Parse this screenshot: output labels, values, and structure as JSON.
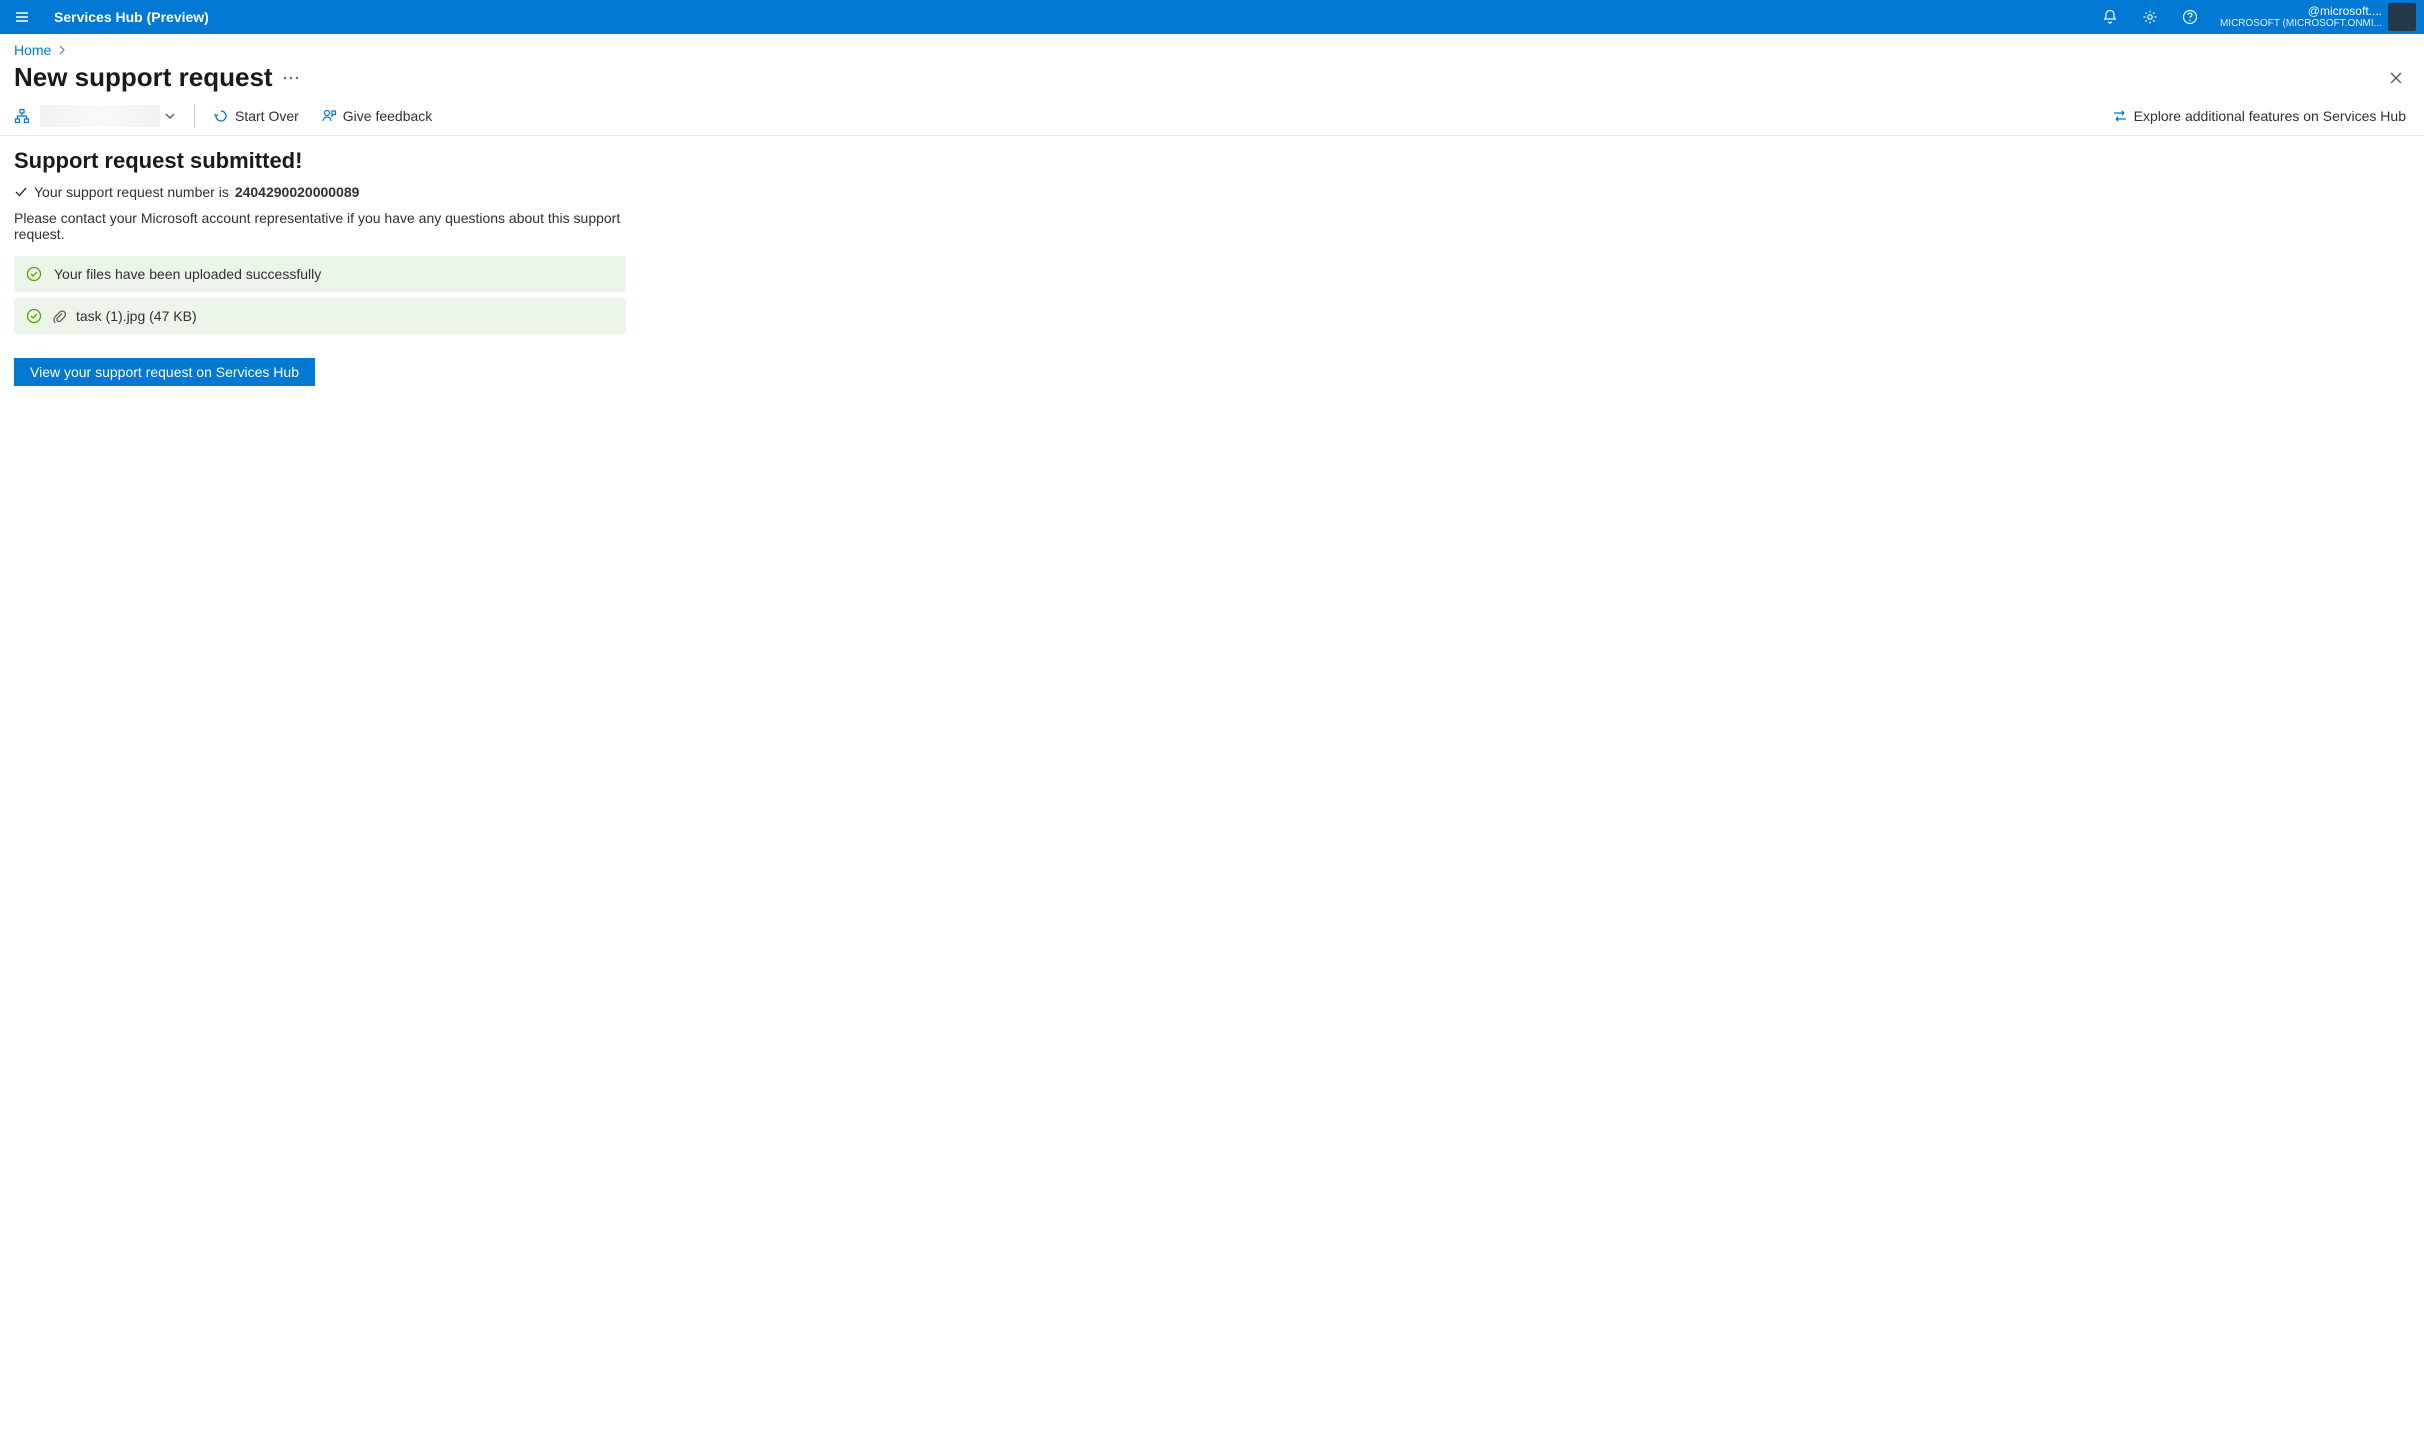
{
  "header": {
    "app_title": "Services Hub (Preview)",
    "account_line1": "@microsoft....",
    "account_line2": "MICROSOFT (MICROSOFT.ONMI..."
  },
  "breadcrumb": {
    "home_label": "Home"
  },
  "page": {
    "title": "New support request"
  },
  "toolbar": {
    "start_over_label": "Start Over",
    "feedback_label": "Give feedback",
    "explore_label": "Explore additional features on Services Hub"
  },
  "content": {
    "submitted_title": "Support request submitted!",
    "req_label": "Your support request number is",
    "req_number": "2404290020000089",
    "contact_text": "Please contact your Microsoft account representative if you have any questions about this support request.",
    "upload_success": "Your files have been uploaded successfully",
    "file_name": "task (1).jpg (47 KB)",
    "view_button": "View your support request on Services Hub"
  }
}
